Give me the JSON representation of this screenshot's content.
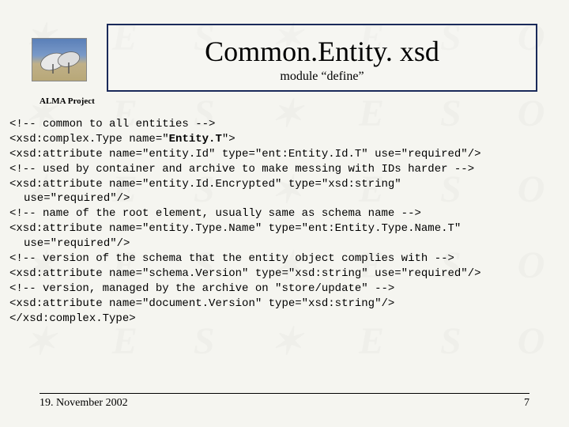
{
  "header": {
    "title": "Common.Entity. xsd",
    "subtitle": "module “define”",
    "project": "ALMA Project"
  },
  "code": {
    "line1": "<!-- common to all entities -->",
    "line2a": "<xsd:complex.Type name=\"",
    "line2b": "Entity.T",
    "line2c": "\">",
    "line3": "<xsd:attribute name=\"entity.Id\" type=\"ent:Entity.Id.T\" use=\"required\"/>",
    "line4": "<!-- used by container and archive to make messing with IDs harder -->",
    "line5": "<xsd:attribute name=\"entity.Id.Encrypted\" type=\"xsd:string\"",
    "line5b": "use=\"required\"/>",
    "line6": "<!-- name of the root element, usually same as schema name -->",
    "line7": "<xsd:attribute name=\"entity.Type.Name\" type=\"ent:Entity.Type.Name.T\"",
    "line7b": "use=\"required\"/>",
    "line8": "<!-- version of the schema that the entity object complies with -->",
    "line9": "<xsd:attribute name=\"schema.Version\" type=\"xsd:string\" use=\"required\"/>",
    "line10": "<!-- version, managed by the archive on \"store/update\" -->",
    "line11": "<xsd:attribute name=\"document.Version\" type=\"xsd:string\"/>",
    "line12": "</xsd:complex.Type>"
  },
  "footer": {
    "date": "19. November 2002",
    "page": "7"
  }
}
